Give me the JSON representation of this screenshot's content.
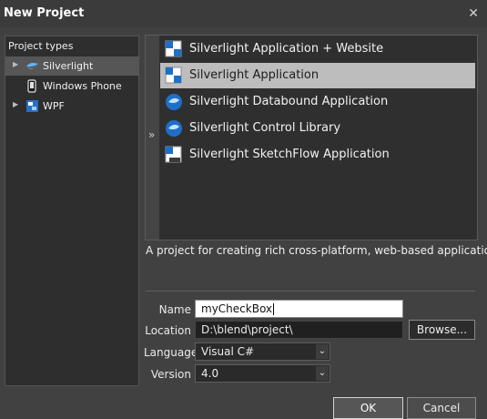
{
  "dialog": {
    "title": "New Project",
    "close_glyph": "✕"
  },
  "project_types": {
    "header": "Project types",
    "items": [
      {
        "label": "Silverlight",
        "icon": "silverlight-icon",
        "expander": "▶"
      },
      {
        "label": "Windows Phone",
        "icon": "phone-icon",
        "expander": ""
      },
      {
        "label": "WPF",
        "icon": "wpf-icon",
        "expander": "▶"
      }
    ],
    "selected_index": 0
  },
  "templates": {
    "collapse_glyph": "»",
    "items": [
      {
        "label": "Silverlight Application + Website",
        "icon": "app-website-icon"
      },
      {
        "label": "Silverlight Application",
        "icon": "app-icon"
      },
      {
        "label": "Silverlight Databound Application",
        "icon": "databound-icon"
      },
      {
        "label": "Silverlight Control Library",
        "icon": "control-library-icon"
      },
      {
        "label": "Silverlight SketchFlow Application",
        "icon": "sketchflow-icon"
      }
    ],
    "selected_index": 1,
    "description": "A project for creating rich cross-platform, web-based applications."
  },
  "form": {
    "name_label": "Name",
    "name_value": "myCheckBox",
    "location_label": "Location",
    "location_value": "D:\\blend\\project\\",
    "browse_label": "Browse...",
    "language_label": "Language",
    "language_value": "Visual C#",
    "version_label": "Version",
    "version_value": "4.0",
    "dropdown_glyph": "⌄"
  },
  "buttons": {
    "ok": "OK",
    "cancel": "Cancel"
  },
  "colors": {
    "accent_blue": "#1f6fc9",
    "selection": "#bdbdbd",
    "background": "#414141"
  }
}
